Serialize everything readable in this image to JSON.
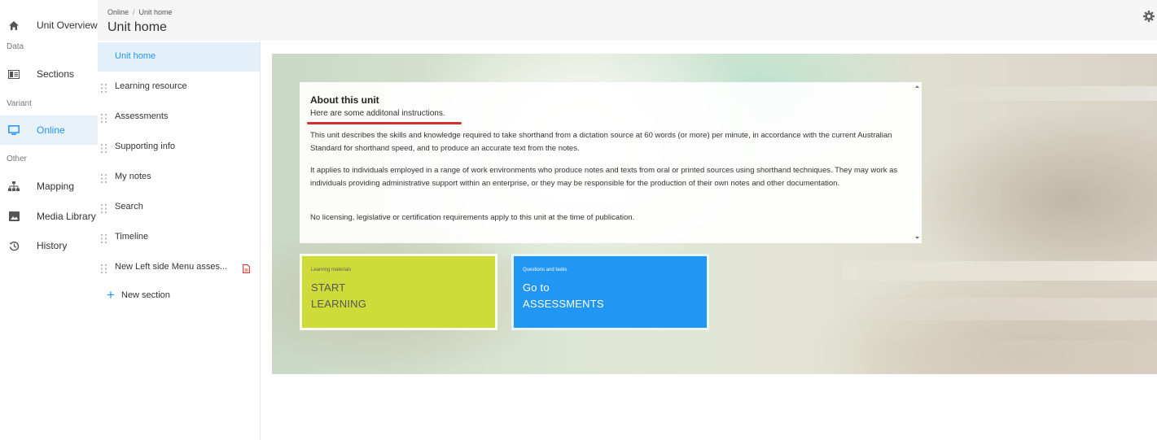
{
  "rail": {
    "items": [
      {
        "label": "Unit Overview",
        "icon": "home-icon"
      },
      {
        "label": "Sections",
        "icon": "sections-icon"
      },
      {
        "label": "Online",
        "icon": "monitor-icon"
      },
      {
        "label": "Mapping",
        "icon": "sitemap-icon"
      },
      {
        "label": "Media Library",
        "icon": "image-icon"
      },
      {
        "label": "History",
        "icon": "history-icon"
      }
    ],
    "groups": {
      "data": "Data",
      "variant": "Variant",
      "other": "Other"
    }
  },
  "header": {
    "breadcrumb": [
      "Online",
      "/",
      "Unit home"
    ],
    "title": "Unit home",
    "settings_icon": "gear-icon"
  },
  "sections": {
    "items": [
      {
        "label": "Unit home"
      },
      {
        "label": "Learning resource"
      },
      {
        "label": "Assessments"
      },
      {
        "label": "Supporting info"
      },
      {
        "label": "My notes"
      },
      {
        "label": "Search"
      },
      {
        "label": "Timeline"
      },
      {
        "label": "New Left side Menu asses..."
      }
    ],
    "new_section_label": "New section"
  },
  "about": {
    "title": "About this unit",
    "instructions": "Here are some additonal instructions.",
    "paragraphs": [
      "This unit describes the skills and knowledge required to take shorthand from a dictation source at 60 words (or more) per minute, in accordance with the current Australian Standard for shorthand speed, and to produce an accurate text from the notes.",
      "It applies to individuals employed in a range of work environments who produce notes and texts from oral or printed sources using shorthand techniques. They may work as individuals providing administrative support within an enterprise, or they may be responsible for the production of their own notes and other documentation.",
      "No licensing, legislative or certification requirements apply to this unit at the time of publication."
    ]
  },
  "tiles": [
    {
      "small": "Learning materials",
      "line1": "START",
      "line2": "LEARNING",
      "color": "#cddc39"
    },
    {
      "small": "Questions and tasks",
      "line1": "Go to",
      "line2": "ASSESSMENTS",
      "color": "#2196f3"
    }
  ],
  "colors": {
    "accent": "#2196f3",
    "highlight": "#d32f2f"
  }
}
